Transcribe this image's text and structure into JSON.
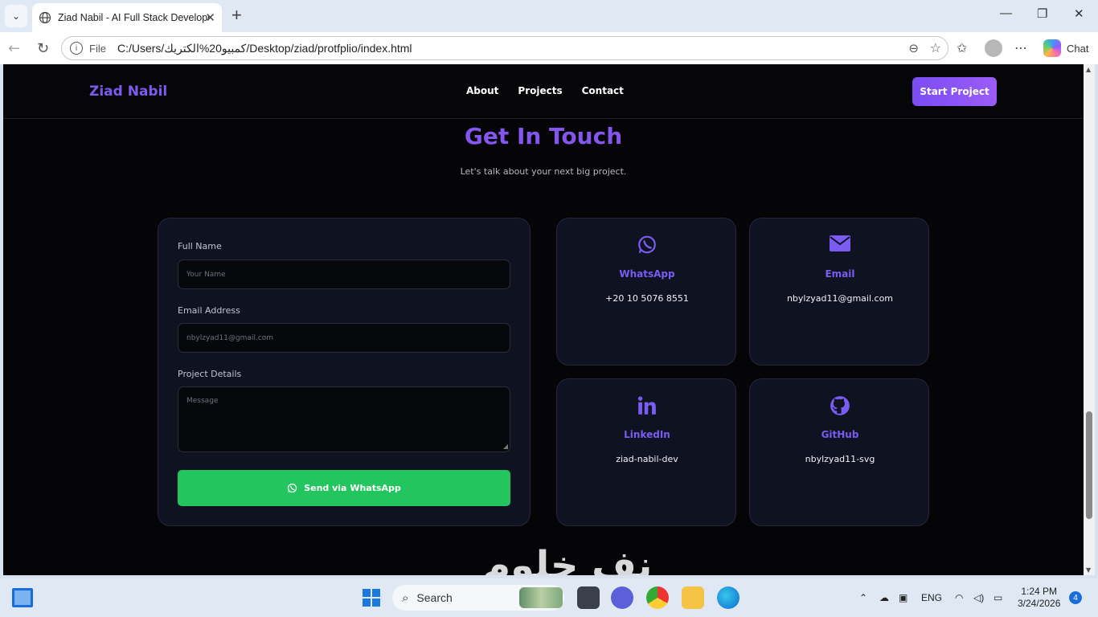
{
  "browser": {
    "tab_title": "Ziad Nabil - AI Full Stack Developer",
    "address_prefix": "File",
    "url": "C:/Users/كمبيو20%الكتريك/Desktop/ziad/protfplio/index.html",
    "chat_label": "Chat"
  },
  "site": {
    "brand": "Ziad Nabil",
    "nav": [
      "About",
      "Projects",
      "Contact"
    ],
    "cta": "Start Project",
    "section_title": "Get In Touch",
    "section_subtitle": "Let's talk about your next big project.",
    "form": {
      "name_label": "Full Name",
      "name_placeholder": "Your Name",
      "email_label": "Email Address",
      "email_placeholder": "nbylzyad11@gmail.com",
      "details_label": "Project Details",
      "details_placeholder": "Message",
      "submit": "Send via WhatsApp"
    },
    "contacts": [
      {
        "title": "WhatsApp",
        "value": "+20 10 5076 8551",
        "icon": "whatsapp-icon"
      },
      {
        "title": "Email",
        "value": "nbylzyad11@gmail.com",
        "icon": "envelope-icon"
      },
      {
        "title": "LinkedIn",
        "value": "ziad-nabil-dev",
        "icon": "linkedin-icon"
      },
      {
        "title": "GitHub",
        "value": "nbylzyad11-svg",
        "icon": "github-icon"
      }
    ],
    "accent_color": "#7c5cf0",
    "whatsapp_color": "#22c55e"
  },
  "taskbar": {
    "search_label": "Search",
    "language": "ENG",
    "time": "1:24 PM",
    "date": "3/24/2026",
    "notification_count": "4"
  }
}
